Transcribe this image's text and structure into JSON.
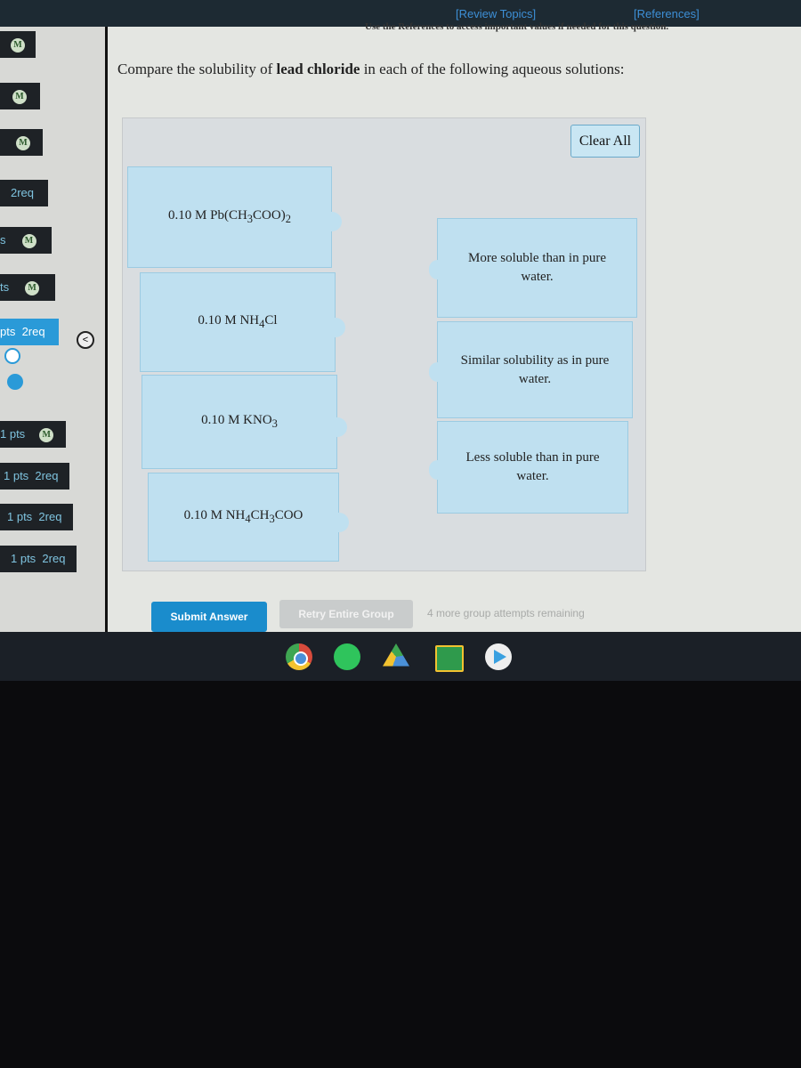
{
  "header": {
    "review_topics": "[Review Topics]",
    "references": "[References]",
    "hint": "Use the References to access important values if needed for this question."
  },
  "sidebar": {
    "items": [
      {
        "label": "",
        "badge": "M"
      },
      {
        "label": "",
        "badge": "M"
      },
      {
        "label": "",
        "badge": "M"
      },
      {
        "label": "2req",
        "badge": ""
      },
      {
        "label": "s",
        "badge": "M"
      },
      {
        "label": "ts",
        "badge": "M"
      },
      {
        "label": "pts  2req",
        "badge": "",
        "active": true
      },
      {
        "label": "1 pts",
        "badge": "M"
      },
      {
        "label": "1 pts  2req",
        "badge": ""
      },
      {
        "label": "1 pts  2req",
        "badge": ""
      },
      {
        "label": "1 pts  2req",
        "badge": ""
      }
    ]
  },
  "question": {
    "prefix": "Compare the solubility of ",
    "bold": "lead chloride",
    "suffix": " in each of the following aqueous solutions:"
  },
  "clear_all": "Clear All",
  "solutions": [
    "0.10 M Pb(CH3COO)2",
    "0.10 M NH4Cl",
    "0.10 M KNO3",
    "0.10 M NH4CH3COO"
  ],
  "targets": [
    "More soluble than in pure water.",
    "Similar solubility as in pure water.",
    "Less soluble than in pure water."
  ],
  "footer": {
    "submit": "Submit Answer",
    "retry": "Retry Entire Group",
    "attempts": "4 more group attempts remaining"
  },
  "taskbar": {
    "apps": [
      "chrome-icon",
      "spotify-icon",
      "drive-icon",
      "classroom-icon",
      "play-store-icon"
    ]
  },
  "colors": {
    "accent": "#2a9ad8",
    "drag_item": "#bfe0f0"
  }
}
